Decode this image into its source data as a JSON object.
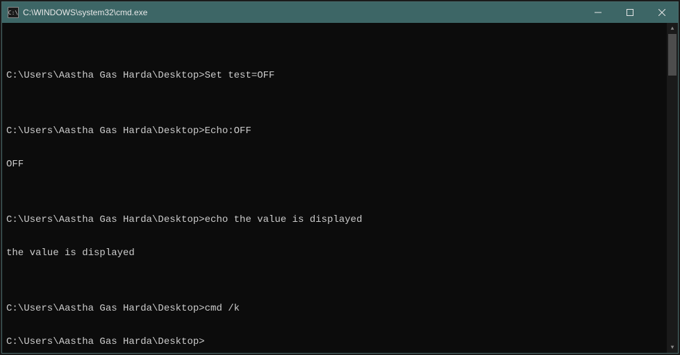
{
  "titlebar": {
    "icon_label": "C:\\",
    "title": "C:\\WINDOWS\\system32\\cmd.exe"
  },
  "terminal": {
    "lines": [
      "",
      "C:\\Users\\Aastha Gas Harda\\Desktop>Set test=OFF",
      "",
      "C:\\Users\\Aastha Gas Harda\\Desktop>Echo:OFF",
      "OFF",
      "",
      "C:\\Users\\Aastha Gas Harda\\Desktop>echo the value is displayed",
      "the value is displayed",
      "",
      "C:\\Users\\Aastha Gas Harda\\Desktop>cmd /k",
      "C:\\Users\\Aastha Gas Harda\\Desktop>"
    ]
  }
}
